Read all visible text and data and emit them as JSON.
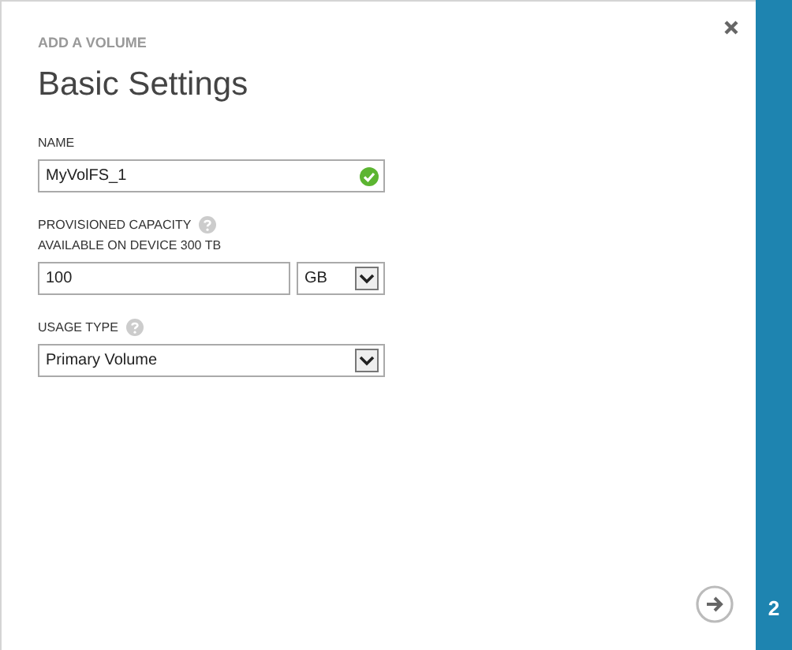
{
  "dialog": {
    "subtitle": "ADD A VOLUME",
    "title": "Basic Settings"
  },
  "fields": [
    {
      "kind": "text",
      "label": "NAME",
      "value": "MyVolFS_1",
      "valid": true
    },
    {
      "kind": "capacity",
      "label": "PROVISIONED CAPACITY",
      "help": true,
      "note": "AVAILABLE ON DEVICE 300 TB",
      "value": "100",
      "unit": "GB"
    },
    {
      "kind": "select",
      "label": "USAGE TYPE",
      "help": true,
      "value": "Primary Volume"
    }
  ],
  "step": "2"
}
